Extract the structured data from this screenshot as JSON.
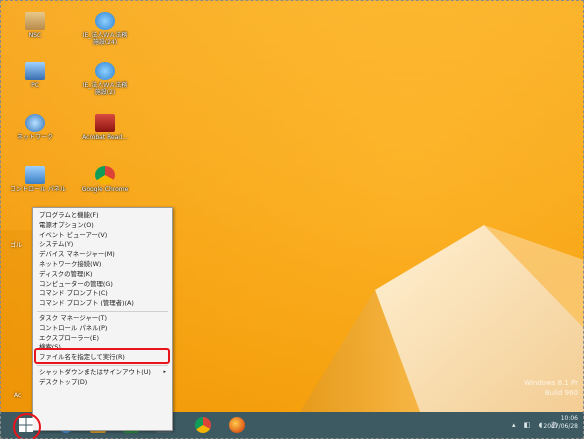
{
  "desktop": {
    "icons": [
      {
        "label": "NSC",
        "icon": "user-folder-icon",
        "color": "#c9a46a"
      },
      {
        "label": "IE_法人ＷＡ法務\n施設(24)",
        "icon": "ie-shortcut-icon",
        "color": "#4a8fd8"
      },
      {
        "label": "PC",
        "icon": "computer-icon",
        "color": "#5b8fc9"
      },
      {
        "label": "IE_法人ＷＡ法務\n施設(2)",
        "icon": "ie-shortcut-icon",
        "color": "#4a8fd8"
      },
      {
        "label": "ネットワーク",
        "icon": "network-icon",
        "color": "#3a7fc4"
      },
      {
        "label": "Acrobat Read...",
        "icon": "acrobat-icon",
        "color": "#b3201d"
      },
      {
        "label": "コントロール パネル",
        "icon": "control-panel-icon",
        "color": "#4b8ed0"
      },
      {
        "label": "Google Chrome",
        "icon": "chrome-icon",
        "color": "#e0b020"
      }
    ],
    "partial_labels": [
      "ゴル",
      "Ac"
    ]
  },
  "context_menu": {
    "group1": [
      "プログラムと機能(F)",
      "電源オプション(O)",
      "イベント ビューアー(V)",
      "システム(Y)",
      "デバイス マネージャー(M)",
      "ネットワーク接続(W)",
      "ディスクの管理(K)",
      "コンピューターの管理(G)",
      "コマンド プロンプト(C)",
      "コマンド プロンプト (管理者)(A)"
    ],
    "group2": [
      "タスク マネージャー(T)",
      "コントロール パネル(P)",
      "エクスプローラー(E)",
      "検索(S)",
      "ファイル名を指定して実行(R)"
    ],
    "group3": [
      "シャットダウンまたはサインアウト(U)",
      "デスクトップ(D)"
    ],
    "submenu_arrow": "▸",
    "highlight_color": "#e8141a"
  },
  "watermark": {
    "line1": "Windows 8.1 Pr",
    "line2": "Build 960"
  },
  "taskbar": {
    "time": "10:06",
    "date": "2017/06/28",
    "tray_glyphs": "▴ ◧ ◖ あ",
    "icons": [
      {
        "name": "ie-taskbar-icon",
        "color": "#2f8fd8"
      },
      {
        "name": "folder-taskbar-icon",
        "color": "#e8b84a"
      },
      {
        "name": "store-taskbar-icon",
        "color": "#3aa04a"
      },
      {
        "name": "app-taskbar-icon",
        "color": "#7a8e94"
      },
      {
        "name": "chrome-taskbar-icon",
        "color": "#e5b52a"
      },
      {
        "name": "firefox-taskbar-icon",
        "color": "#e36a1f"
      }
    ]
  }
}
